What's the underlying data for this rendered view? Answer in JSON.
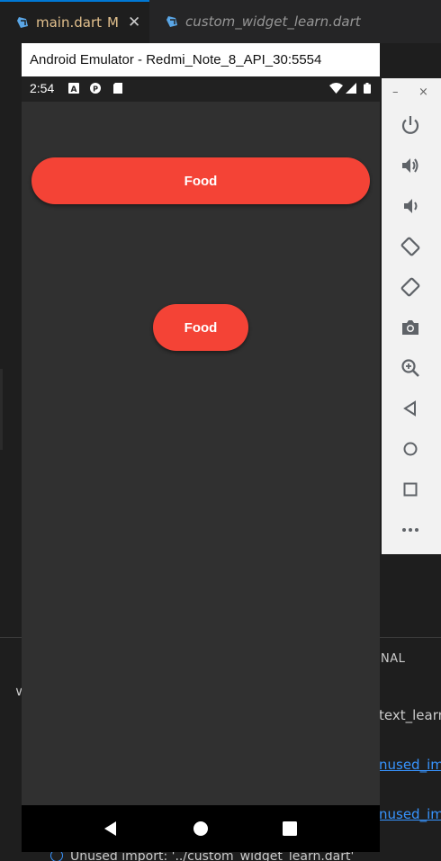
{
  "editor": {
    "tabs": [
      {
        "label": "main.dart",
        "modified": "M",
        "close": "✕",
        "active": true
      },
      {
        "label": "custom_widget_learn.dart",
        "active": false
      }
    ]
  },
  "panel": {
    "tab_label": "NAL",
    "lines": [
      "text_learn_",
      "nused_imp",
      "nused_imp"
    ],
    "info_text": "Unused import: '../custom_widget_learn.dart'"
  },
  "emulator": {
    "title": "Android Emulator - Redmi_Note_8_API_30:5554",
    "status_time": "2:54",
    "toolbar": {
      "minimize": "–",
      "close": "×",
      "buttons": [
        "power-icon",
        "volume-up-icon",
        "volume-down-icon",
        "rotate-left-icon",
        "rotate-right-icon",
        "camera-icon",
        "zoom-icon",
        "back-icon",
        "home-icon",
        "overview-icon",
        "more-icon"
      ]
    }
  },
  "app": {
    "button_wide_label": "Food",
    "button_small_label": "Food",
    "button_color": "#f44336",
    "background_color": "#303030"
  }
}
